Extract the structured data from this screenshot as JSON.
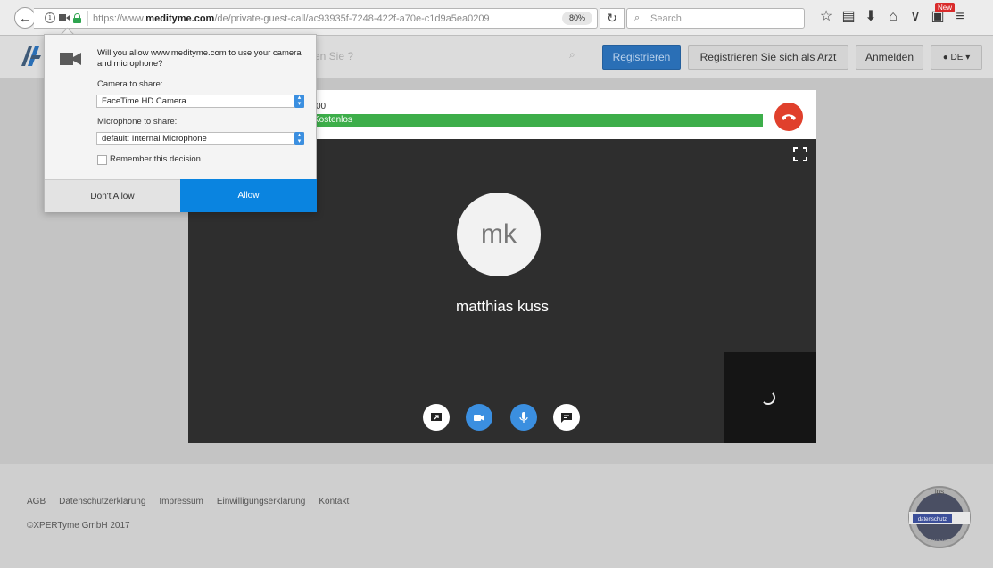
{
  "browser": {
    "url_prefix": "https://www.",
    "url_domain": "medityme.com",
    "url_path": "/de/private-guest-call/ac93935f-7248-422f-a70e-c1d9a5ea0209",
    "zoom": "80%",
    "search_placeholder": "Search",
    "new_badge": "New",
    "icons": [
      "star-icon",
      "reading-list-icon",
      "download-icon",
      "home-icon",
      "pocket-icon",
      "gift-icon",
      "menu-icon"
    ]
  },
  "header": {
    "search_placeholder_visible": "en Sie ?",
    "register_label": "Registrieren",
    "doctor_register_label": "Registrieren Sie sich als Arzt",
    "login_label": "Anmelden",
    "lang_label": "● DE ▾"
  },
  "call": {
    "time_partial": "00",
    "plan_partial": "Kostenlos",
    "avatar_initials": "mk",
    "caller_name": "matthias kuss"
  },
  "footer": {
    "links": [
      "AGB",
      "Datenschutzerklärung",
      "Impressum",
      "Einwilligungserklärung",
      "Kontakt"
    ],
    "copyright": "©XPERTyme GmbH 2017",
    "seal": {
      "top": "ips",
      "band": "datenschutz",
      "bottom": "ZERTIFIZIERT"
    }
  },
  "permission_popup": {
    "question": "Will you allow www.medityme.com to use your camera and microphone?",
    "camera_label": "Camera to share:",
    "camera_value": "FaceTime HD Camera",
    "mic_label": "Microphone to share:",
    "mic_value": "default: Internal Microphone",
    "remember_label": "Remember this decision",
    "remember_checked": false,
    "deny_label": "Don't Allow",
    "allow_label": "Allow"
  },
  "colors": {
    "accent_blue": "#0a84e0",
    "register_blue": "#2a6fb6",
    "progress_green": "#3dae4a",
    "hangup_red": "#e0402c"
  }
}
